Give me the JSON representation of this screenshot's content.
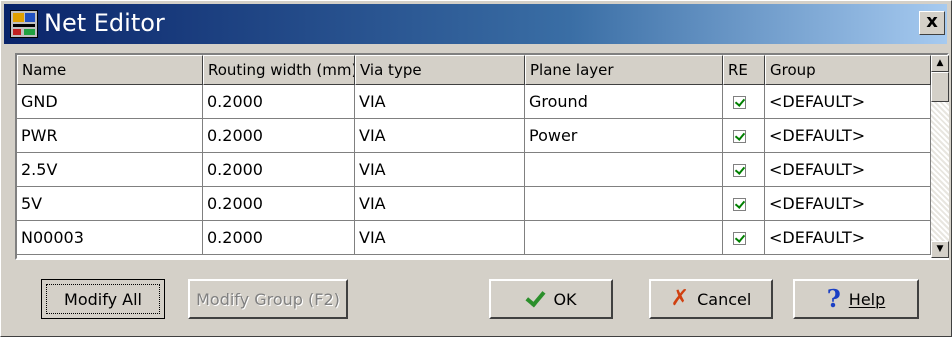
{
  "window": {
    "title": "Net Editor",
    "close_label": "x"
  },
  "grid": {
    "columns": [
      "Name",
      "Routing width (mm)",
      "Via type",
      "Plane layer",
      "RE",
      "Group"
    ],
    "rows": [
      {
        "name": "GND",
        "width": "0.2000",
        "via": "VIA",
        "plane": "Ground",
        "re": true,
        "group": "<DEFAULT>"
      },
      {
        "name": "PWR",
        "width": "0.2000",
        "via": "VIA",
        "plane": "Power",
        "re": true,
        "group": "<DEFAULT>"
      },
      {
        "name": "2.5V",
        "width": "0.2000",
        "via": "VIA",
        "plane": "",
        "re": true,
        "group": "<DEFAULT>"
      },
      {
        "name": "5V",
        "width": "0.2000",
        "via": "VIA",
        "plane": "",
        "re": true,
        "group": "<DEFAULT>"
      },
      {
        "name": "N00003",
        "width": "0.2000",
        "via": "VIA",
        "plane": "",
        "re": true,
        "group": "<DEFAULT>"
      }
    ]
  },
  "buttons": {
    "modify_all": "Modify All",
    "modify_group": "Modify Group (F2)",
    "ok": "OK",
    "cancel": "Cancel",
    "help": "Help"
  },
  "icons": {
    "ok": "check-icon",
    "cancel": "x-icon",
    "help": "question-icon"
  },
  "colors": {
    "title_start": "#0a246a",
    "title_end": "#a6caf0",
    "face": "#d4d0c8",
    "check": "#008000"
  }
}
